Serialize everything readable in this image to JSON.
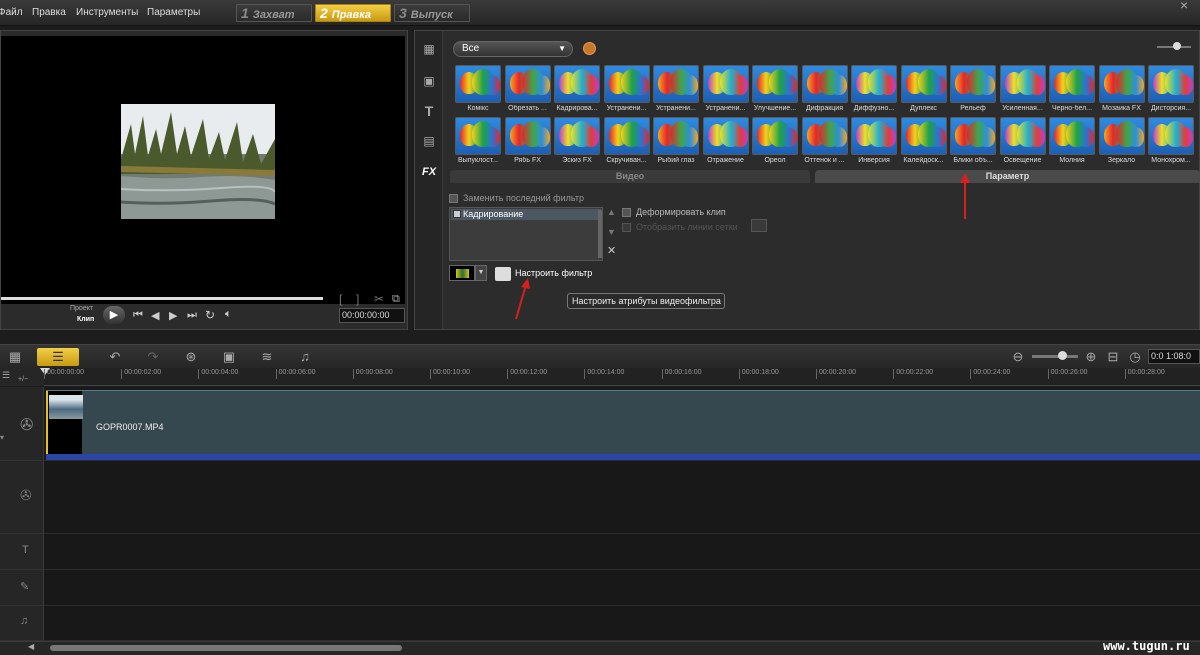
{
  "menu": [
    "Файл",
    "Правка",
    "Инструменты",
    "Параметры"
  ],
  "steps": [
    {
      "num": "1",
      "label": "Захват",
      "active": false
    },
    {
      "num": "2",
      "label": "Правка",
      "active": true
    },
    {
      "num": "3",
      "label": "Выпуск",
      "active": false
    }
  ],
  "window_close": "×",
  "preview": {
    "mode_project": "Проект",
    "mode_clip": "Клип",
    "timecode": "00:00:00:00",
    "bracket_left": "[",
    "bracket_right": "]"
  },
  "library": {
    "category": "Все",
    "filters_row1": [
      "Комікс",
      "Обрезать ...",
      "Кадрирова...",
      "Устранени...",
      "Устранени...",
      "Устранени...",
      "Улучшение...",
      "Дифракция",
      "Диффузно...",
      "Дуплекс",
      "Рельеф",
      "Усиленная...",
      "Черно-бел...",
      "Мозаика FX",
      "Дисторсия..."
    ],
    "filters_row2": [
      "Выпуклост...",
      "Рябь FX",
      "Эскиз FX",
      "Скручиван...",
      "Рыбий глаз",
      "Отражение",
      "Ореол",
      "Оттенок и ...",
      "Инверсия",
      "Калейдоск...",
      "Блики объ...",
      "Освещение",
      "Молния",
      "Зеркало",
      "Монохром..."
    ],
    "tab_video": "Видео",
    "tab_param": "Параметр",
    "replace_last": "Заменить последний фильтр",
    "applied_filter": "Кадрирование",
    "deform_clip": "Деформировать клип",
    "show_grid": "Отобразить линии сетки",
    "customize_filter": "Настроить фильтр",
    "tooltip": "Настроить атрибуты видеофильтра",
    "remove": "✕"
  },
  "timeline": {
    "timecode": "0:0 1:08:0",
    "ruler": [
      "00:00:00:00",
      "00:00:02:00",
      "00:00:04:00",
      "00:00:06:00",
      "00:00:08:00",
      "00:00:10:00",
      "00:00:12:00",
      "00:00:14:00",
      "00:00:16:00",
      "00:00:18:00",
      "00:00:20:00",
      "00:00:22:00",
      "00:00:24:00",
      "00:00:26:00",
      "00:00:28:00"
    ],
    "clip_name": "GOPR0007.MP4"
  },
  "watermark": "www.tugun.ru",
  "colors": {
    "accent": "#e8bd2c",
    "arrow": "#d81f1f",
    "clip": "#35474f"
  }
}
